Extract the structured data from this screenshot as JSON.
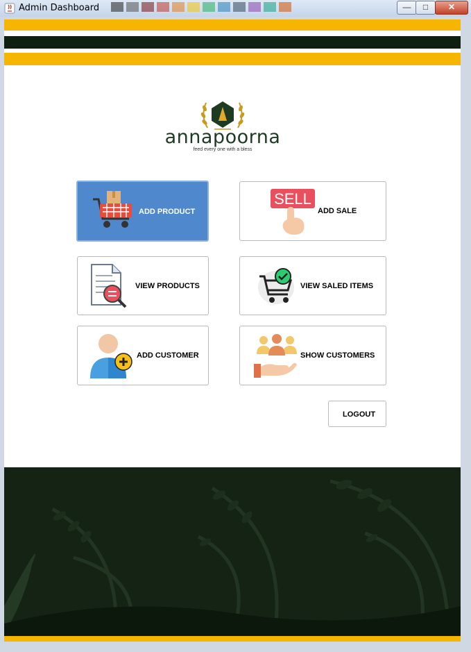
{
  "window": {
    "title": "Admin Dashboard",
    "minimize_icon": "minimize-icon",
    "maximize_icon": "maximize-icon",
    "close_icon": "close-icon"
  },
  "colors": {
    "accent_yellow": "#f6b500",
    "dark_green": "#102010",
    "active_tile": "#4f88cc"
  },
  "brand": {
    "name": "annapoorna",
    "tagline": "feed every one with a bless"
  },
  "tiles": {
    "add_product": {
      "label": "ADD PRODUCT",
      "icon": "shopping-cart-icon"
    },
    "add_sale": {
      "label": "ADD SALE",
      "sign": "SELL",
      "icon": "sell-hand-icon"
    },
    "view_products": {
      "label": "VIEW PRODUCTS",
      "icon": "document-search-icon"
    },
    "view_saled_items": {
      "label": "VIEW SALED ITEMS",
      "icon": "cart-check-icon"
    },
    "add_customer": {
      "label": "ADD CUSTOMER",
      "icon": "add-user-icon"
    },
    "show_customers": {
      "label": "SHOW CUSTOMERS",
      "icon": "customers-hand-icon"
    }
  },
  "logout": {
    "label": "LOGOUT"
  }
}
